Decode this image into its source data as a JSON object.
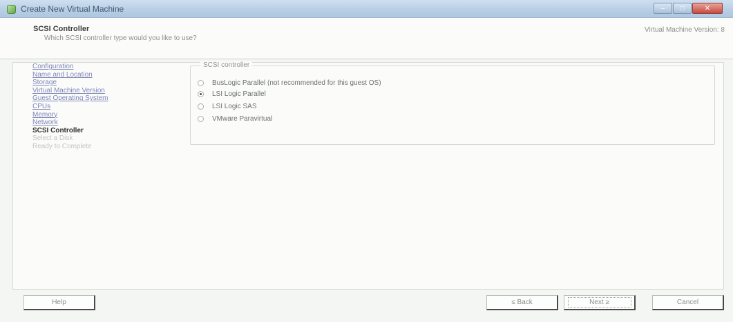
{
  "window": {
    "title": "Create New Virtual Machine",
    "controls": {
      "minimize": "–",
      "maximize": "□",
      "close": "✕"
    }
  },
  "header": {
    "title": "SCSI Controller",
    "subtitle": "Which SCSI controller type would you like to use?",
    "vm_version": "Virtual Machine Version: 8"
  },
  "steps": [
    {
      "label": "Configuration",
      "state": "done"
    },
    {
      "label": "Name and Location",
      "state": "done"
    },
    {
      "label": "Storage",
      "state": "done"
    },
    {
      "label": "Virtual Machine Version",
      "state": "done"
    },
    {
      "label": "Guest Operating System",
      "state": "done"
    },
    {
      "label": "CPUs",
      "state": "done"
    },
    {
      "label": "Memory",
      "state": "done"
    },
    {
      "label": "Network",
      "state": "done"
    },
    {
      "label": "SCSI Controller",
      "state": "current"
    },
    {
      "label": "Select a Disk",
      "state": "pending"
    },
    {
      "label": "Ready to Complete",
      "state": "pending"
    }
  ],
  "scsi_group": {
    "legend": "SCSI controller",
    "options": [
      {
        "label": "BusLogic Parallel (not recommended for this guest OS)",
        "selected": false
      },
      {
        "label": "LSI Logic Parallel",
        "selected": true
      },
      {
        "label": "LSI Logic SAS",
        "selected": false
      },
      {
        "label": "VMware Paravirtual",
        "selected": false
      }
    ]
  },
  "footer": {
    "help": "Help",
    "back": "≤ Back",
    "next": "Next ≥",
    "cancel": "Cancel"
  }
}
